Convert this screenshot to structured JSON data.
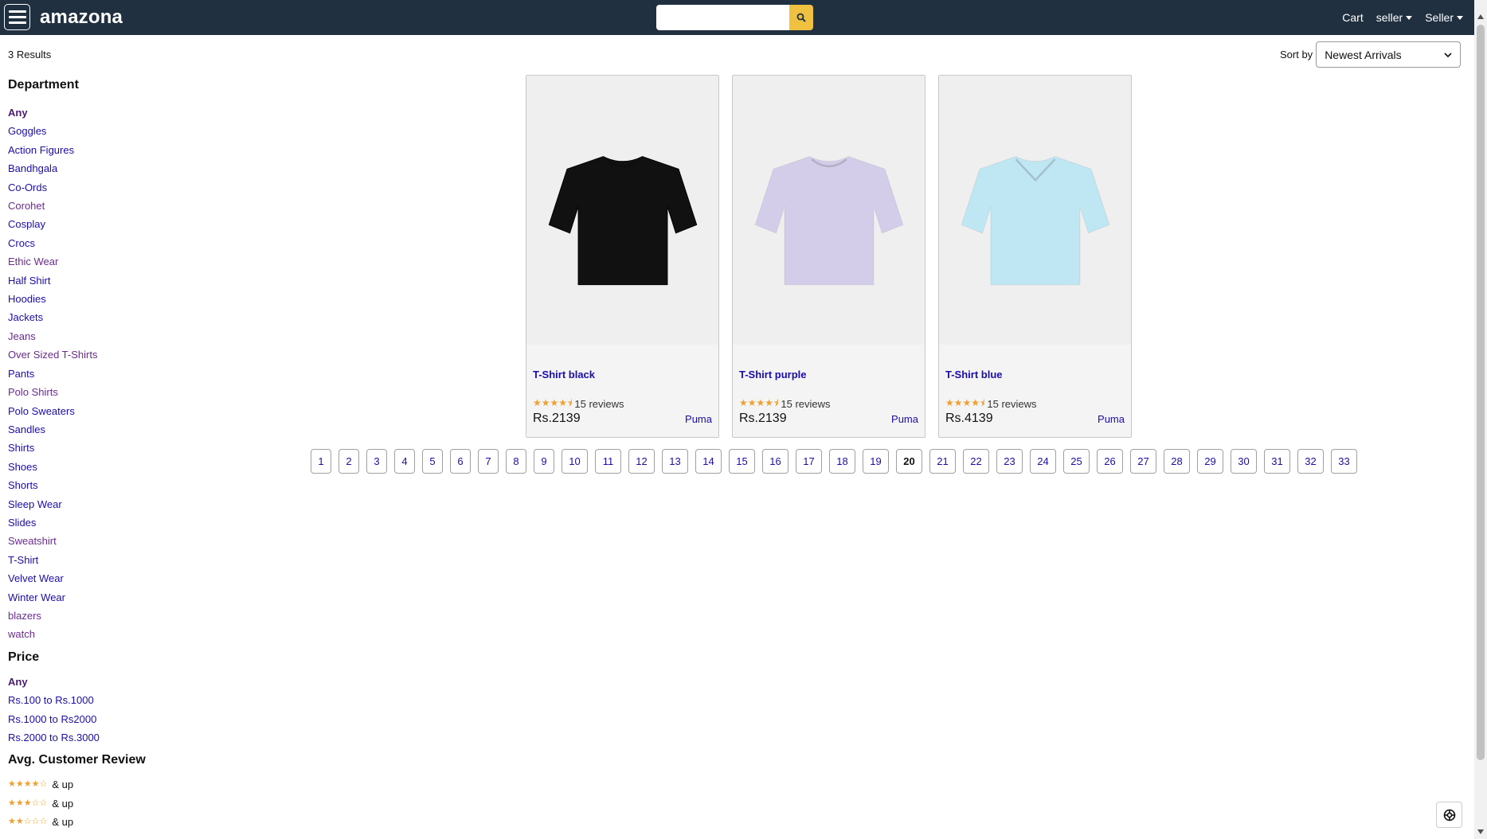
{
  "app": {
    "brand": "amazona",
    "search_placeholder": ""
  },
  "nav": {
    "cart_label": "Cart",
    "user_label": "seller",
    "seller_label": "Seller"
  },
  "results": {
    "count_text": "3 Results",
    "sort_label": "Sort by",
    "sort_value": "Newest Arrivals"
  },
  "sidebar": {
    "department_title": "Department",
    "departments": [
      "Any",
      "Goggles",
      "Action Figures",
      "Bandhgala",
      "Co-Ords",
      "Corohet",
      "Cosplay",
      "Crocs",
      "Ethic Wear",
      "Half Shirt",
      "Hoodies",
      "Jackets",
      "Jeans",
      "Over Sized T-Shirts",
      "Pants",
      "Polo Shirts",
      "Polo Sweaters",
      "Sandles",
      "Shirts",
      "Shoes",
      "Shorts",
      "Sleep Wear",
      "Slides",
      "Sweatshirt",
      "T-Shirt",
      "Velvet Wear",
      "Winter Wear",
      "blazers",
      "watch"
    ],
    "price_title": "Price",
    "prices": [
      "Any",
      "Rs.100 to Rs.1000",
      "Rs.1000 to Rs2000",
      "Rs.2000 to Rs.3000"
    ],
    "review_title": "Avg. Customer Review",
    "reviews": [
      {
        "stars": "★★★★☆",
        "text": "& up"
      },
      {
        "stars": "★★★☆☆",
        "text": "& up"
      },
      {
        "stars": "★★☆☆☆",
        "text": "& up"
      }
    ]
  },
  "products": [
    {
      "name": "T-Shirt black",
      "reviews": "15 reviews",
      "price": "Rs.2139",
      "brand": "Puma",
      "color": "#111111",
      "rating": 4.5,
      "stars": "★★★★⯨"
    },
    {
      "name": "T-Shirt purple",
      "reviews": "15 reviews",
      "price": "Rs.2139",
      "brand": "Puma",
      "color": "#d4cdea",
      "rating": 4.5,
      "stars": "★★★★⯨"
    },
    {
      "name": "T-Shirt blue",
      "reviews": "15 reviews",
      "price": "Rs.4139",
      "brand": "Puma",
      "color": "#bfe6f3",
      "rating": 4.5,
      "stars": "★★★★⯨"
    }
  ],
  "pagination": {
    "pages": [
      "1",
      "2",
      "3",
      "4",
      "5",
      "6",
      "7",
      "8",
      "9",
      "10",
      "11",
      "12",
      "13",
      "14",
      "15",
      "16",
      "17",
      "18",
      "19",
      "20",
      "21",
      "22",
      "23",
      "24",
      "25",
      "26",
      "27",
      "28",
      "29",
      "30",
      "31",
      "32",
      "33"
    ],
    "current": "20"
  },
  "colors": {
    "navbar": "#203040",
    "accent": "#f0c040",
    "link": "#1a0dab"
  }
}
